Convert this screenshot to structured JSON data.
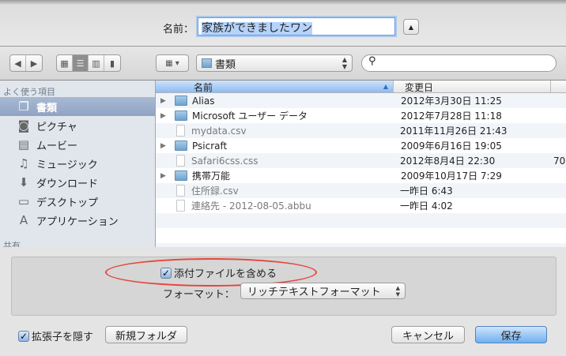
{
  "save_as": {
    "label": "名前：",
    "value": "家族ができましたワン"
  },
  "toolbar": {
    "location": "書類",
    "search_placeholder": ""
  },
  "sidebar": {
    "section_favorites": "よく使う項目",
    "section_shared": "共有",
    "items": [
      {
        "label": "書類",
        "icon": "documents-icon",
        "selected": true
      },
      {
        "label": "ピクチャ",
        "icon": "camera-icon"
      },
      {
        "label": "ムービー",
        "icon": "film-icon"
      },
      {
        "label": "ミュージック",
        "icon": "music-note-icon"
      },
      {
        "label": "ダウンロード",
        "icon": "download-icon"
      },
      {
        "label": "デスクトップ",
        "icon": "desktop-icon"
      },
      {
        "label": "アプリケーション",
        "icon": "applications-icon"
      }
    ]
  },
  "files": {
    "columns": {
      "name": "名前",
      "date": "変更日"
    },
    "rows": [
      {
        "name": "Alias",
        "date": "2012年3月30日 11:25",
        "type": "folder"
      },
      {
        "name": "Microsoft ユーザー データ",
        "date": "2012年7月28日 11:18",
        "type": "folder"
      },
      {
        "name": "mydata.csv",
        "date": "2011年11月26日 21:43",
        "type": "file"
      },
      {
        "name": "Psicraft",
        "date": "2009年6月16日 19:05",
        "type": "folder"
      },
      {
        "name": "Safari6css.css",
        "date": "2012年8月4日 22:30",
        "type": "file",
        "extra": "70"
      },
      {
        "name": "携帯万能",
        "date": "2009年10月17日 7:29",
        "type": "folder"
      },
      {
        "name": "住所録.csv",
        "date": "一昨日 6:43",
        "type": "file"
      },
      {
        "name": "連絡先 - 2012-08-05.abbu",
        "date": "一昨日 4:02",
        "type": "file"
      }
    ]
  },
  "options": {
    "include_attachments": "添付ファイルを含める",
    "format_label": "フォーマット：",
    "format_value": "リッチテキストフォーマット"
  },
  "footer": {
    "hide_extension": "拡張子を隠す",
    "new_folder": "新規フォルダ",
    "cancel": "キャンセル",
    "save": "保存"
  },
  "colors": {
    "highlight_oval": "#e6463c",
    "accent": "#6fb0f0"
  }
}
